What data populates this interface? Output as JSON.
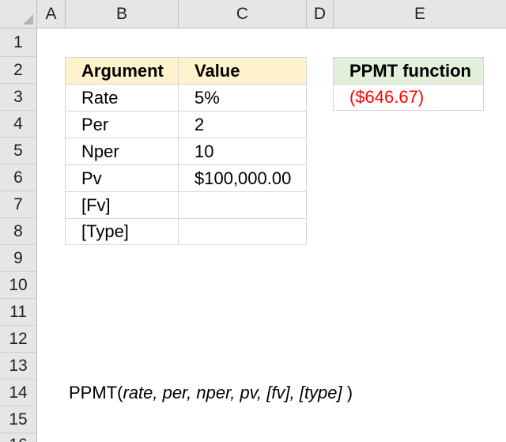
{
  "columns": [
    "A",
    "B",
    "C",
    "D",
    "E"
  ],
  "rows": [
    "1",
    "2",
    "3",
    "4",
    "5",
    "6",
    "7",
    "8",
    "9",
    "10",
    "11",
    "12",
    "13",
    "14",
    "15",
    "16"
  ],
  "table": {
    "headers": [
      "Argument",
      "Value"
    ],
    "rows": [
      [
        "Rate",
        "5%"
      ],
      [
        "Per",
        "2"
      ],
      [
        "Nper",
        "10"
      ],
      [
        "Pv",
        "$100,000.00"
      ],
      [
        "[Fv]",
        ""
      ],
      [
        "[Type]",
        ""
      ]
    ]
  },
  "result": {
    "header": "PPMT function",
    "value": "($646.67)"
  },
  "syntax": {
    "fn": "PPMT(",
    "args": "rate, per, nper, pv, [fv], [type]",
    "close": " )"
  },
  "colors": {
    "header_orange": "#fff2cc",
    "header_green": "#e2efda",
    "negative": "#ff0000"
  }
}
